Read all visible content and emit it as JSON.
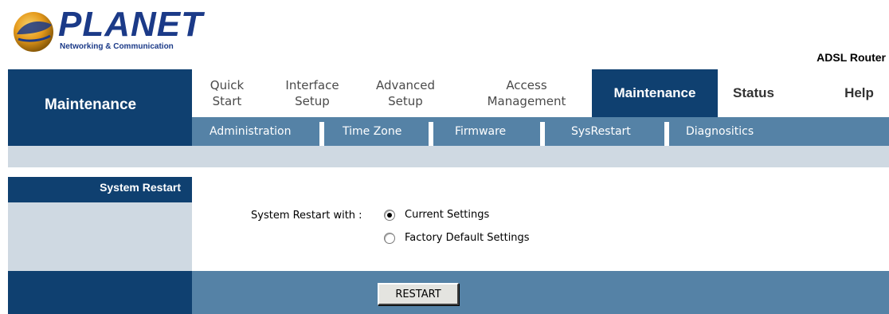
{
  "brand": {
    "name": "PLANET",
    "tagline": "Networking & Communication",
    "product": "ADSL Router",
    "colors": {
      "primary": "#0f4070",
      "secondary": "#5582a6",
      "light": "#cfd9e2"
    }
  },
  "sidebar": {
    "title": "Maintenance"
  },
  "nav": {
    "quick_start_1": "Quick",
    "quick_start_2": "Start",
    "interface_1": "Interface",
    "interface_2": "Setup",
    "advanced_1": "Advanced",
    "advanced_2": "Setup",
    "access_1": "Access",
    "access_2": "Management",
    "maintenance": "Maintenance",
    "status": "Status",
    "help": "Help"
  },
  "subnav": {
    "administration": "Administration",
    "time_zone": "Time Zone",
    "firmware": "Firmware",
    "sysrestart": "SysRestart",
    "diagnostics": "Diagnositics"
  },
  "section": {
    "title": "System Restart"
  },
  "form": {
    "label": "System Restart with :",
    "option_current": "Current Settings",
    "option_factory": "Factory Default Settings",
    "selected": "current"
  },
  "actions": {
    "restart": "RESTART"
  }
}
